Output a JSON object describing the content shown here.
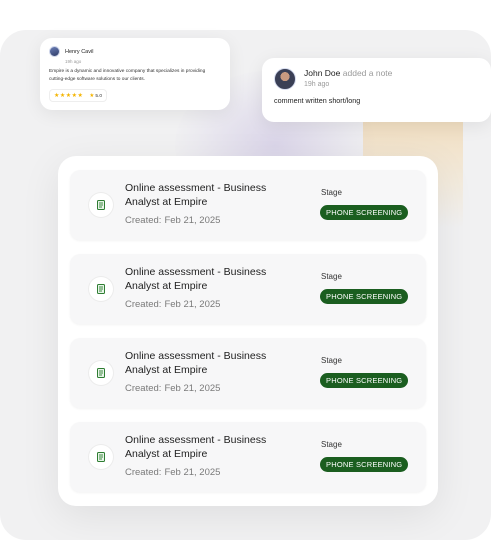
{
  "review": {
    "name": "Henry Cavil",
    "time": "19h ago",
    "text": "Empire is a dynamic and innovative company that specializes in providing cutting-edge software solutions to our clients.",
    "stars": "★★★★★",
    "score": "5.0"
  },
  "note": {
    "author": "John Doe",
    "action": "added a note",
    "time": "19h ago",
    "body": "comment written short/long"
  },
  "assessments": [
    {
      "title": "Online assessment - Business Analyst at Empire",
      "created_label": "Created:",
      "created_date": "Feb 21, 2025",
      "stage_label": "Stage",
      "stage": "PHONE SCREENING"
    },
    {
      "title": "Online assessment - Business Analyst at Empire",
      "created_label": "Created:",
      "created_date": "Feb 21, 2025",
      "stage_label": "Stage",
      "stage": "PHONE SCREENING"
    },
    {
      "title": "Online assessment - Business Analyst at Empire",
      "created_label": "Created:",
      "created_date": "Feb 21, 2025",
      "stage_label": "Stage",
      "stage": "PHONE SCREENING"
    },
    {
      "title": "Online assessment - Business Analyst at Empire",
      "created_label": "Created:",
      "created_date": "Feb 21, 2025",
      "stage_label": "Stage",
      "stage": "PHONE SCREENING"
    }
  ],
  "colors": {
    "stage_badge": "#1b5e20",
    "star": "#f4b400",
    "doc_icon": "#2e7d32"
  },
  "icons": {
    "assessment": "document-icon",
    "rating": "star-icon"
  }
}
